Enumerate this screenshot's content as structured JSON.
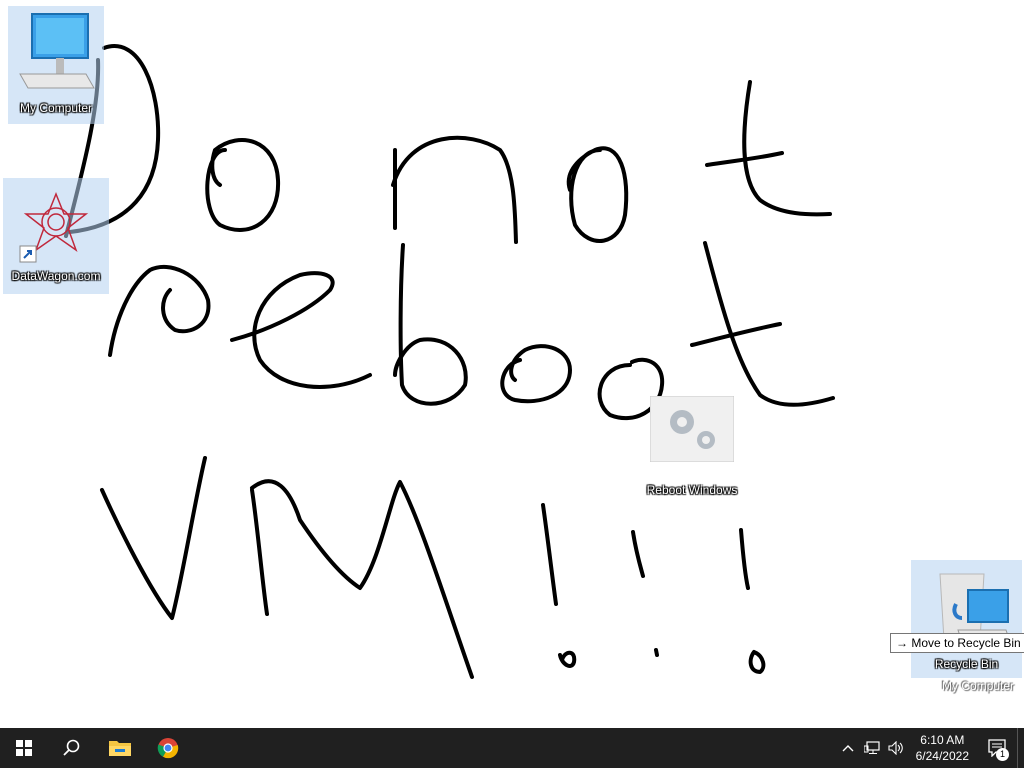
{
  "desktop": {
    "icons": [
      {
        "label": "My Computer"
      },
      {
        "label": "DataWagon.com"
      },
      {
        "label": "Reboot Windows"
      },
      {
        "label": "Recycle Bin"
      }
    ],
    "drag_tooltip": "→ Move to Recycle Bin",
    "dragged_item_label": "My Computer",
    "handwriting": "Do not reboot VM!!!"
  },
  "taskbar": {
    "apps": [
      {
        "icon": "windows-start-icon"
      },
      {
        "icon": "search-icon"
      },
      {
        "icon": "file-explorer-icon"
      },
      {
        "icon": "chrome-icon"
      }
    ],
    "clock": {
      "time": "6:10 AM",
      "date": "6/24/2022"
    },
    "notification_count": "1"
  }
}
